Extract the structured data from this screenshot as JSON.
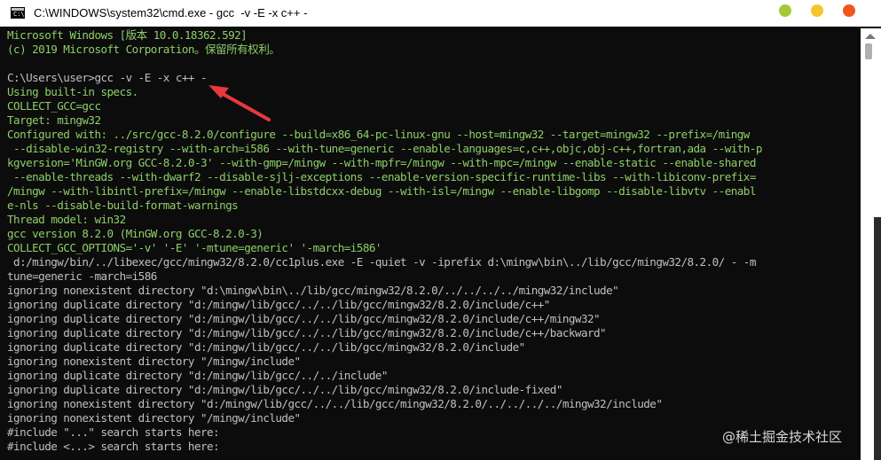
{
  "window": {
    "title": "C:\\WINDOWS\\system32\\cmd.exe - gcc  -v -E -x c++ -",
    "icon_label": "C:\\",
    "controls": [
      "minimize",
      "maximize",
      "close"
    ]
  },
  "console": {
    "lines": [
      {
        "text": "Microsoft Windows [版本 10.0.18362.592]",
        "color": "green"
      },
      {
        "text": "(c) 2019 Microsoft Corporation。保留所有权利。",
        "color": "green"
      },
      {
        "text": "",
        "color": "green"
      },
      {
        "text": "C:\\Users\\user>gcc -v -E -x c++ -",
        "color": "gray"
      },
      {
        "text": "Using built-in specs.",
        "color": "green"
      },
      {
        "text": "COLLECT_GCC=gcc",
        "color": "green"
      },
      {
        "text": "Target: mingw32",
        "color": "green"
      },
      {
        "text": "Configured with: ../src/gcc-8.2.0/configure --build=x86_64-pc-linux-gnu --host=mingw32 --target=mingw32 --prefix=/mingw",
        "color": "green"
      },
      {
        "text": " --disable-win32-registry --with-arch=i586 --with-tune=generic --enable-languages=c,c++,objc,obj-c++,fortran,ada --with-p",
        "color": "green"
      },
      {
        "text": "kgversion='MinGW.org GCC-8.2.0-3' --with-gmp=/mingw --with-mpfr=/mingw --with-mpc=/mingw --enable-static --enable-shared",
        "color": "green"
      },
      {
        "text": " --enable-threads --with-dwarf2 --disable-sjlj-exceptions --enable-version-specific-runtime-libs --with-libiconv-prefix=",
        "color": "green"
      },
      {
        "text": "/mingw --with-libintl-prefix=/mingw --enable-libstdcxx-debug --with-isl=/mingw --enable-libgomp --disable-libvtv --enabl",
        "color": "green"
      },
      {
        "text": "e-nls --disable-build-format-warnings",
        "color": "green"
      },
      {
        "text": "Thread model: win32",
        "color": "green"
      },
      {
        "text": "gcc version 8.2.0 (MinGW.org GCC-8.2.0-3)",
        "color": "green"
      },
      {
        "text": "COLLECT_GCC_OPTIONS='-v' '-E' '-mtune=generic' '-march=i586'",
        "color": "green"
      },
      {
        "text": " d:/mingw/bin/../libexec/gcc/mingw32/8.2.0/cc1plus.exe -E -quiet -v -iprefix d:\\mingw\\bin\\../lib/gcc/mingw32/8.2.0/ - -m",
        "color": "gray"
      },
      {
        "text": "tune=generic -march=i586",
        "color": "gray"
      },
      {
        "text": "ignoring nonexistent directory \"d:\\mingw\\bin\\../lib/gcc/mingw32/8.2.0/../../../../mingw32/include\"",
        "color": "gray"
      },
      {
        "text": "ignoring duplicate directory \"d:/mingw/lib/gcc/../../lib/gcc/mingw32/8.2.0/include/c++\"",
        "color": "gray"
      },
      {
        "text": "ignoring duplicate directory \"d:/mingw/lib/gcc/../../lib/gcc/mingw32/8.2.0/include/c++/mingw32\"",
        "color": "gray"
      },
      {
        "text": "ignoring duplicate directory \"d:/mingw/lib/gcc/../../lib/gcc/mingw32/8.2.0/include/c++/backward\"",
        "color": "gray"
      },
      {
        "text": "ignoring duplicate directory \"d:/mingw/lib/gcc/../../lib/gcc/mingw32/8.2.0/include\"",
        "color": "gray"
      },
      {
        "text": "ignoring nonexistent directory \"/mingw/include\"",
        "color": "gray"
      },
      {
        "text": "ignoring duplicate directory \"d:/mingw/lib/gcc/../../include\"",
        "color": "gray"
      },
      {
        "text": "ignoring duplicate directory \"d:/mingw/lib/gcc/../../lib/gcc/mingw32/8.2.0/include-fixed\"",
        "color": "gray"
      },
      {
        "text": "ignoring nonexistent directory \"d:/mingw/lib/gcc/../../lib/gcc/mingw32/8.2.0/../../../../mingw32/include\"",
        "color": "gray"
      },
      {
        "text": "ignoring nonexistent directory \"/mingw/include\"",
        "color": "gray"
      },
      {
        "text": "#include \"...\" search starts here:",
        "color": "gray"
      },
      {
        "text": "#include <...> search starts here:",
        "color": "gray"
      }
    ]
  },
  "watermark": "@稀土掘金技术社区",
  "colors": {
    "console_bg": "#0c0c0c",
    "text_green": "#8dcf69",
    "text_gray": "#c0c0c0",
    "arrow": "#e8383c"
  }
}
